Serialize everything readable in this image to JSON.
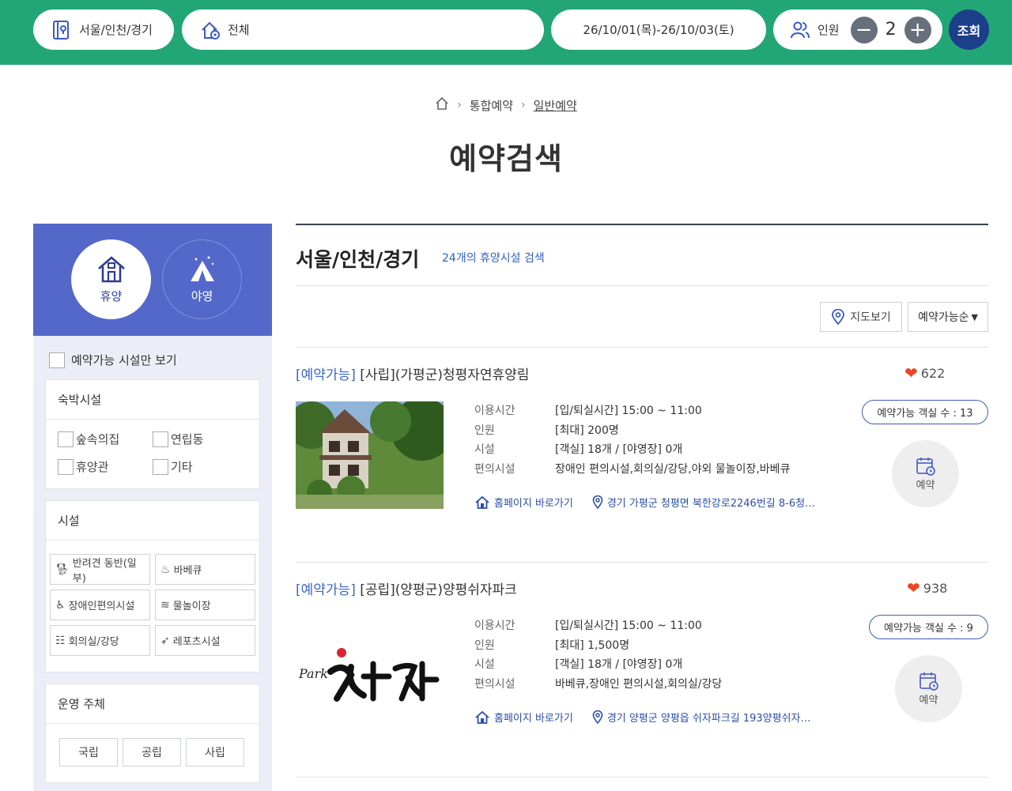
{
  "header": {
    "region": "서울/인천/경기",
    "type": "전체",
    "dates": "26/10/01(목)-26/10/03(토)",
    "people_label": "인원",
    "minus": "−",
    "plus": "+",
    "people_count": "2",
    "search_label": "조회",
    "accent_color": "#22a676"
  },
  "breadcrumb": {
    "level1": "통합예약",
    "level2": "일반예약"
  },
  "page_title": "예약검색",
  "sidebar": {
    "categories": [
      {
        "label": "휴양",
        "icon": "house-icon",
        "active": true
      },
      {
        "label": "야영",
        "icon": "tent-icon",
        "active": false
      }
    ],
    "available_only": "예약가능 시설만 보기",
    "lodging": {
      "title": "숙박시설",
      "options": [
        "숲속의집",
        "연립동",
        "휴양관",
        "기타"
      ]
    },
    "facilities": {
      "title": "시설",
      "items": [
        "반려견 동반(일부)",
        "바베큐",
        "장애인편의시설",
        "물놀이장",
        "회의실/강당",
        "레포츠시설"
      ]
    },
    "operator": {
      "title": "운영 주체",
      "options": [
        "국립",
        "공립",
        "사립"
      ]
    }
  },
  "results": {
    "region_title": "서울/인천/경기",
    "count_text": "24개의 휴양시설 검색",
    "map_button": "지도보기",
    "sort": "예약가능순",
    "labels": {
      "time": "이용시간",
      "people": "인원",
      "facility": "시설",
      "amenities": "편의시설",
      "homepage": "홈페이지 바로가기",
      "reserve": "예약"
    },
    "items": [
      {
        "status": "[예약가능]",
        "name": "[사립](가평군)청평자연휴양림",
        "likes": "622",
        "rooms": "예약가능 객실 수 : 13",
        "time": "[입/퇴실시간] 15:00 ~ 11:00",
        "people": "[최대] 200명",
        "facility": "[객실] 18개 / [야영장] 0개",
        "amenities": "장애인 편의시설,회의실/강당,야외 물놀이장,바베큐",
        "address": "경기 가평군 청평면 북한강로2246번길 8-6청…"
      },
      {
        "status": "[예약가능]",
        "name": "[공립](양평군)양평쉬자파크",
        "likes": "938",
        "rooms": "예약가능 객실 수 : 9",
        "time": "[입/퇴실시간] 15:00 ~ 11:00",
        "people": "[최대] 1,500명",
        "facility": "[객실] 18개 / [야영장] 0개",
        "amenities": "바베큐,장애인 편의시설,회의실/강당",
        "address": "경기 양평군 양평읍 쉬자파크길 193양평쉬자…",
        "logo_text": "Park 쉬자"
      }
    ]
  }
}
